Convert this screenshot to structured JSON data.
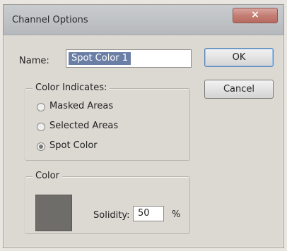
{
  "window": {
    "title": "Channel Options",
    "close_label": "×"
  },
  "name_field": {
    "label": "Name:",
    "value": "Spot Color 1"
  },
  "buttons": {
    "ok": "OK",
    "cancel": "Cancel"
  },
  "color_indicates": {
    "legend": "Color Indicates:",
    "options": [
      {
        "label": "Masked Areas",
        "checked": false
      },
      {
        "label": "Selected Areas",
        "checked": false
      },
      {
        "label": "Spot Color",
        "checked": true
      }
    ]
  },
  "color_group": {
    "legend": "Color",
    "swatch_color": "#6e6d6a",
    "solidity_label": "Solidity:",
    "solidity_value": "50",
    "solidity_unit": "%"
  },
  "colors": {
    "selection_highlight": "#6b7fa6",
    "close_button": "#c47e74",
    "dialog_bg": "#dcd8d2"
  }
}
